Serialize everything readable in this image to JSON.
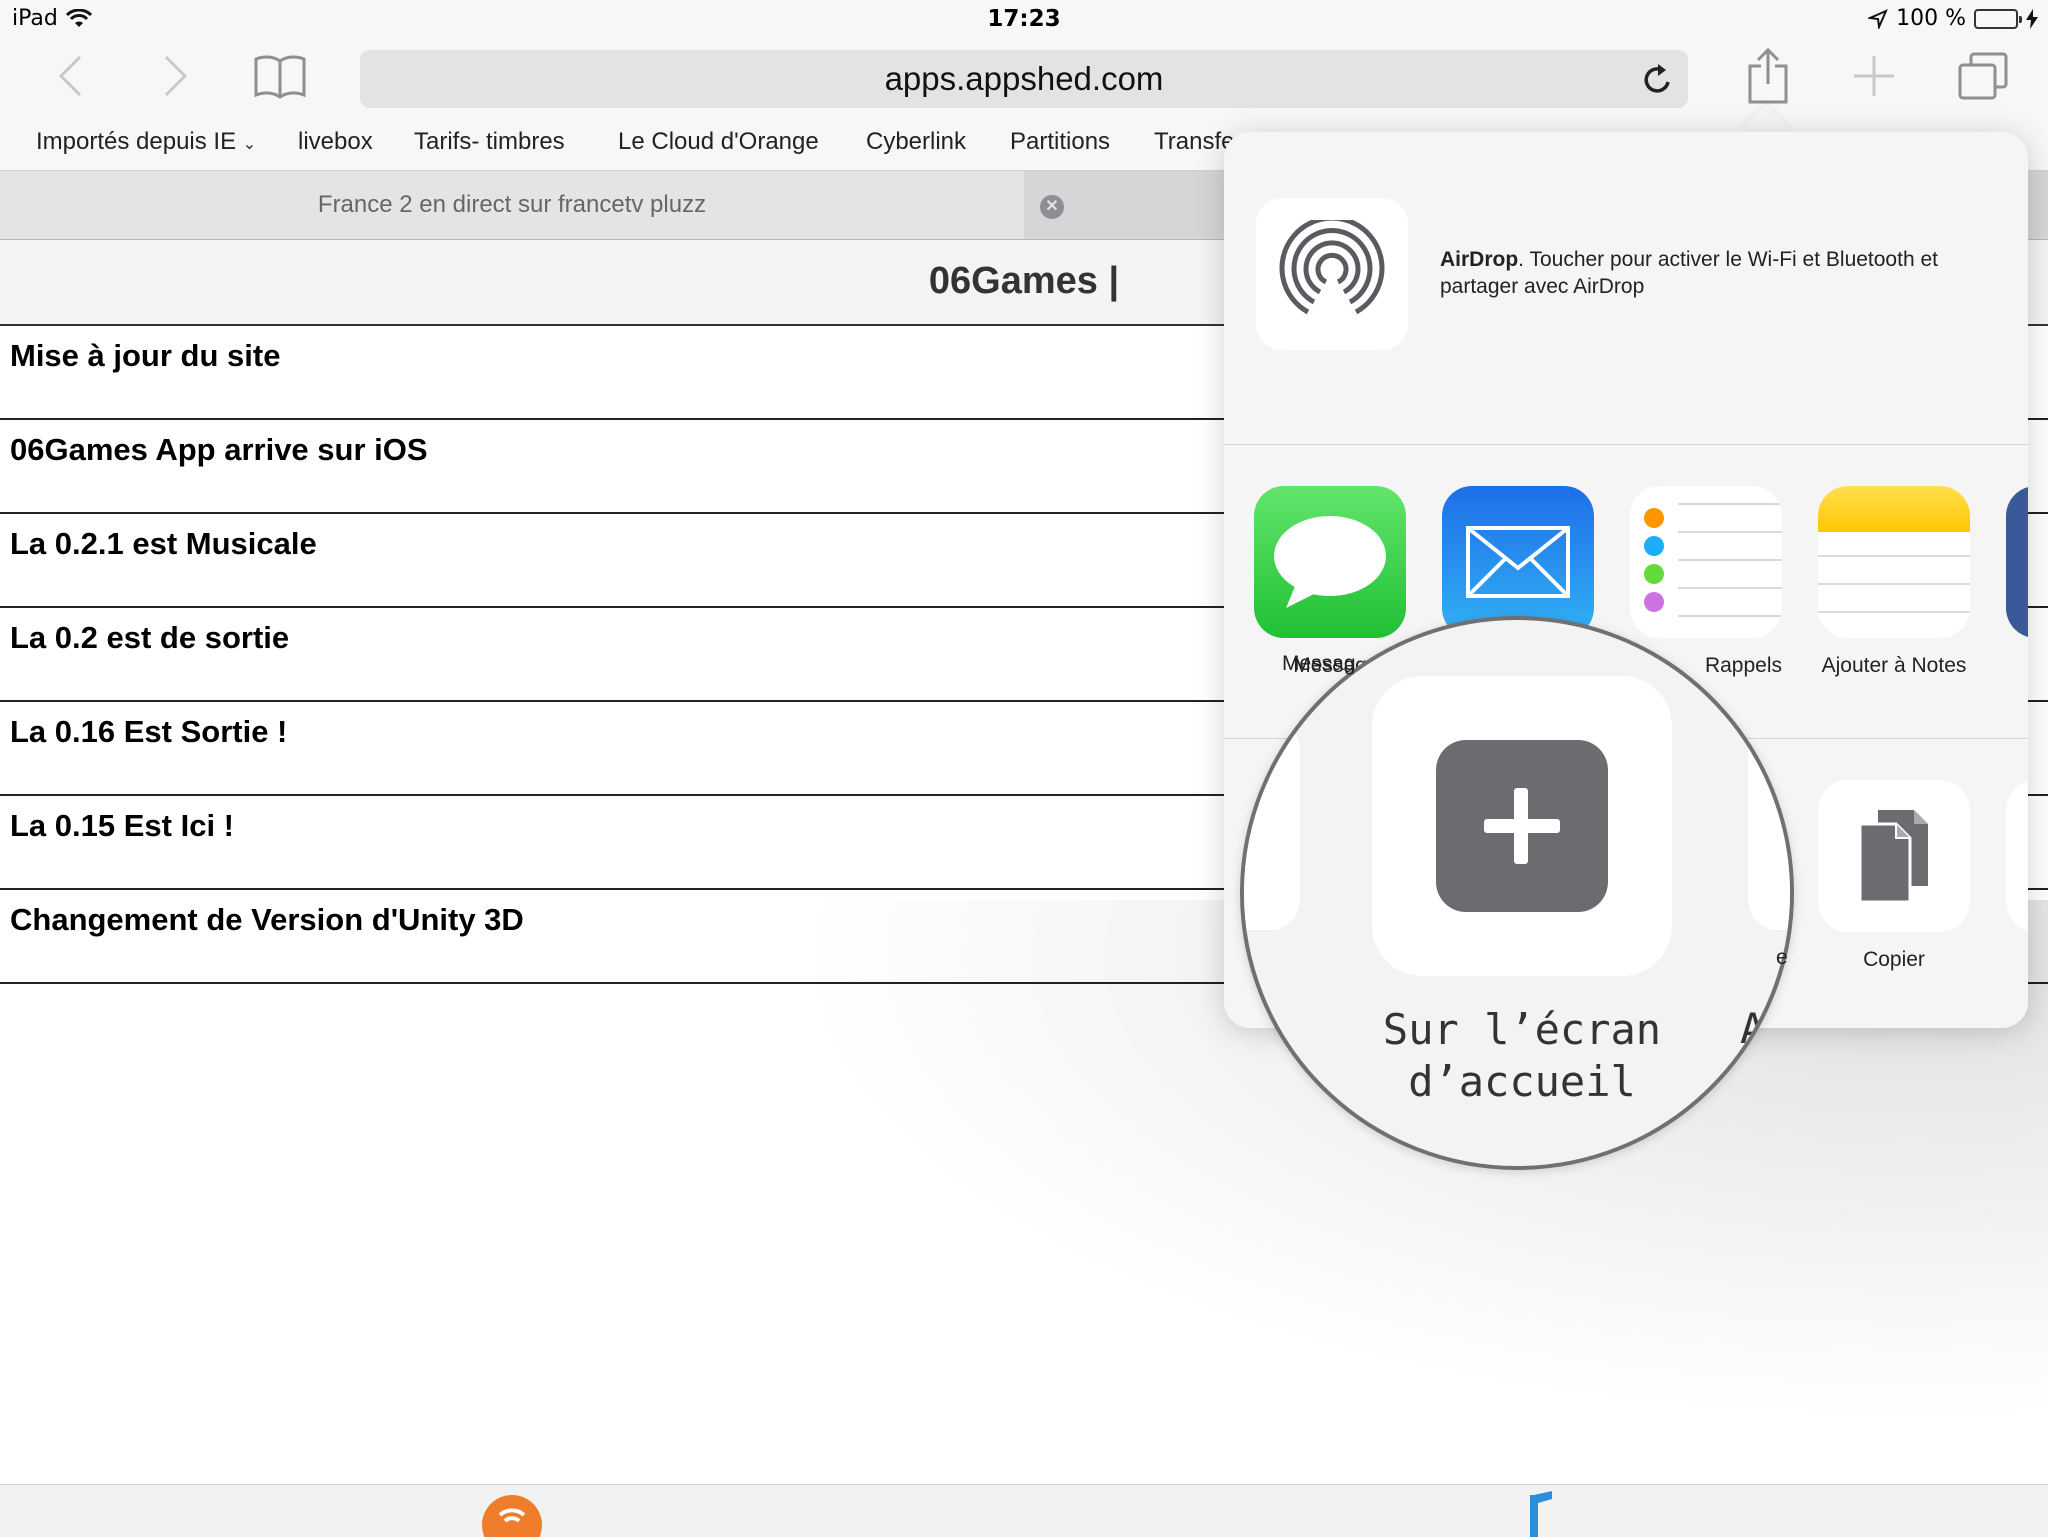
{
  "status": {
    "device": "iPad",
    "time": "17:23",
    "battery": "100 %"
  },
  "toolbar": {
    "url": "apps.appshed.com"
  },
  "bookmarks": [
    "Importés depuis IE",
    "livebox",
    "Tarifs- timbres",
    "Le Cloud d'Orange",
    "Cyberlink",
    "Partitions",
    "Transfe"
  ],
  "tab": {
    "title": "France 2 en direct sur francetv pluzz",
    "close": "✕"
  },
  "page": {
    "header": "06Games |",
    "news": [
      "Mise à jour du site",
      "06Games App arrive sur iOS",
      "La 0.2.1 est Musicale",
      "La 0.2 est de sortie",
      "La 0.16 Est Sortie !",
      "La 0.15 Est Ici !",
      "Changement de Version d'Unity 3D"
    ]
  },
  "share": {
    "airdrop_title": "AirDrop",
    "airdrop_desc": ". Toucher pour activer le Wi-Fi et Bluetooth et partager avec AirDrop",
    "apps": [
      {
        "label": "Messag",
        "icon": "messages-icon"
      },
      {
        "label": "",
        "icon": "mail-icon"
      },
      {
        "label": "Rappels",
        "icon": "reminders-icon"
      },
      {
        "label": "Ajouter à Notes",
        "icon": "notes-icon"
      }
    ],
    "actions": {
      "copy": "Copier",
      "partial": "e"
    },
    "magnifier": {
      "label": "Sur l’écran d’accueil",
      "partial": "A"
    }
  },
  "colors": {
    "messages": "#34c84a",
    "mail": "#1e88f0",
    "notes": "#ffcc00",
    "orange": "#ef7d2c"
  }
}
